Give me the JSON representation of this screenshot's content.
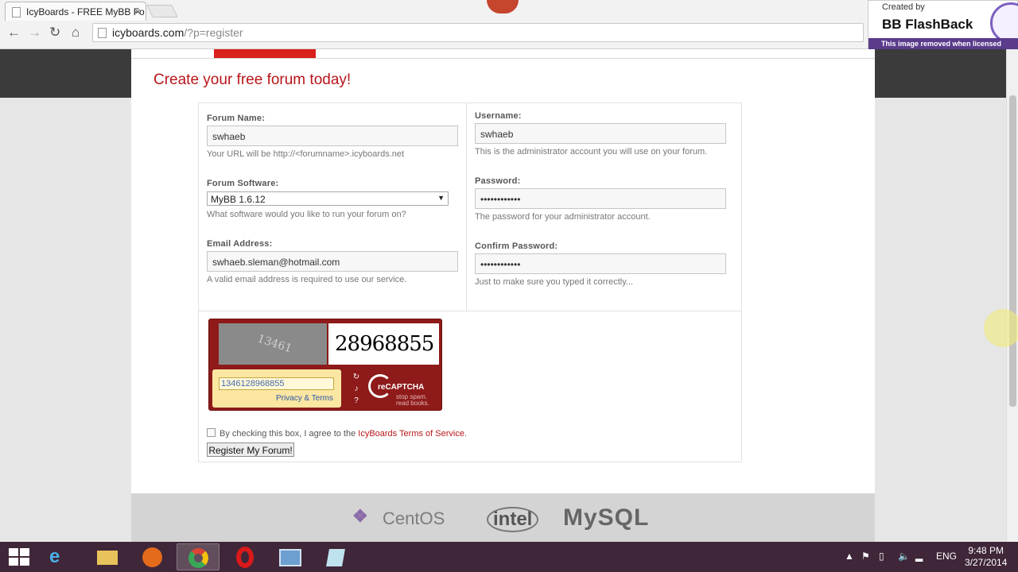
{
  "browser": {
    "tab_title": "IcyBoards - FREE MyBB Fo",
    "url_host": "icyboards.com",
    "url_rest": "/?p=register"
  },
  "watermark": {
    "created_by": "Created by",
    "brand": "BB FlashBack",
    "notice": "This image removed when licensed"
  },
  "page": {
    "heading": "Create your free forum today!",
    "fields": {
      "forum_name_label": "Forum Name:",
      "forum_name_value": "swhaeb",
      "forum_name_hint": "Your URL will be http://<forumname>.icyboards.net",
      "software_label": "Forum Software:",
      "software_value": "MyBB 1.6.12",
      "software_hint": "What software would you like to run your forum on?",
      "email_label": "Email Address:",
      "email_value": "swhaeb.sleman@hotmail.com",
      "email_hint": "A valid email address is required to use our service.",
      "username_label": "Username:",
      "username_value": "swhaeb",
      "username_hint": "This is the administrator account you will use on your forum.",
      "password_label": "Password:",
      "password_value": "••••••••••••",
      "password_hint": "The password for your administrator account.",
      "confirm_label": "Confirm Password:",
      "confirm_value": "••••••••••••",
      "confirm_hint": "Just to make sure you typed it correctly..."
    },
    "captcha": {
      "word1": "13461",
      "word2": "28968855",
      "response": "1346128968855",
      "privacy": "Privacy & Terms",
      "brand_a": "reCAPTCHA",
      "brand_b": "stop spam. read books."
    },
    "agree_prefix": "By checking this box, I agree to the ",
    "agree_link": "IcyBoards Terms of Service",
    "agree_suffix": ".",
    "register_button": "Register My Forum!",
    "footer_logos": [
      "CentOS",
      "intel",
      "MySQL"
    ]
  },
  "taskbar": {
    "language": "ENG",
    "time": "9:48 PM",
    "date": "3/27/2014"
  },
  "colors": {
    "accent": "#b8161a",
    "captcha_bg": "#8e1a1a",
    "taskbar": "#3f2638"
  }
}
